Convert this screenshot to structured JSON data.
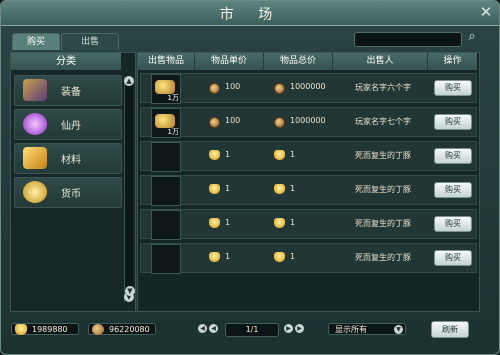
{
  "window": {
    "title": "市 场",
    "close_icon": "close-icon"
  },
  "tabs": [
    {
      "label": "购买",
      "active": true
    },
    {
      "label": "出售",
      "active": false
    }
  ],
  "search": {
    "value": "",
    "icon": "search-icon"
  },
  "categories": {
    "header": "分类",
    "items": [
      {
        "label": "装备",
        "icon": "equipment-icon"
      },
      {
        "label": "仙丹",
        "icon": "elixir-icon"
      },
      {
        "label": "材料",
        "icon": "material-icon"
      },
      {
        "label": "货币",
        "icon": "currency-icon"
      }
    ]
  },
  "table": {
    "columns": [
      "出售物品",
      "物品单价",
      "物品总价",
      "出售人",
      "操作"
    ],
    "rows": [
      {
        "item_qty": "1万",
        "has_item": true,
        "price_currency": "coin",
        "unit_price": "100",
        "total_price": "1000000",
        "seller": "玩家名字六个字",
        "action": "购买"
      },
      {
        "item_qty": "1万",
        "has_item": true,
        "price_currency": "coin",
        "unit_price": "100",
        "total_price": "1000000",
        "seller": "玩家名字七个字",
        "action": "购买"
      },
      {
        "item_qty": "",
        "has_item": false,
        "price_currency": "ingot",
        "unit_price": "1",
        "total_price": "1",
        "seller": "死而复生的丁豚",
        "action": "购买"
      },
      {
        "item_qty": "",
        "has_item": false,
        "price_currency": "ingot",
        "unit_price": "1",
        "total_price": "1",
        "seller": "死而复生的丁豚",
        "action": "购买"
      },
      {
        "item_qty": "",
        "has_item": false,
        "price_currency": "ingot",
        "unit_price": "1",
        "total_price": "1",
        "seller": "死而复生的丁豚",
        "action": "购买"
      },
      {
        "item_qty": "",
        "has_item": false,
        "price_currency": "ingot",
        "unit_price": "1",
        "total_price": "1",
        "seller": "死而复生的丁豚",
        "action": "购买"
      }
    ]
  },
  "footer": {
    "gold_ingot": "1989880",
    "copper_coin": "96220080",
    "page": "1/1",
    "filter": "显示所有",
    "refresh": "刷新"
  },
  "colors": {
    "gold": "#d89a17",
    "coin": "#8f5a24",
    "panel": "#162525"
  }
}
